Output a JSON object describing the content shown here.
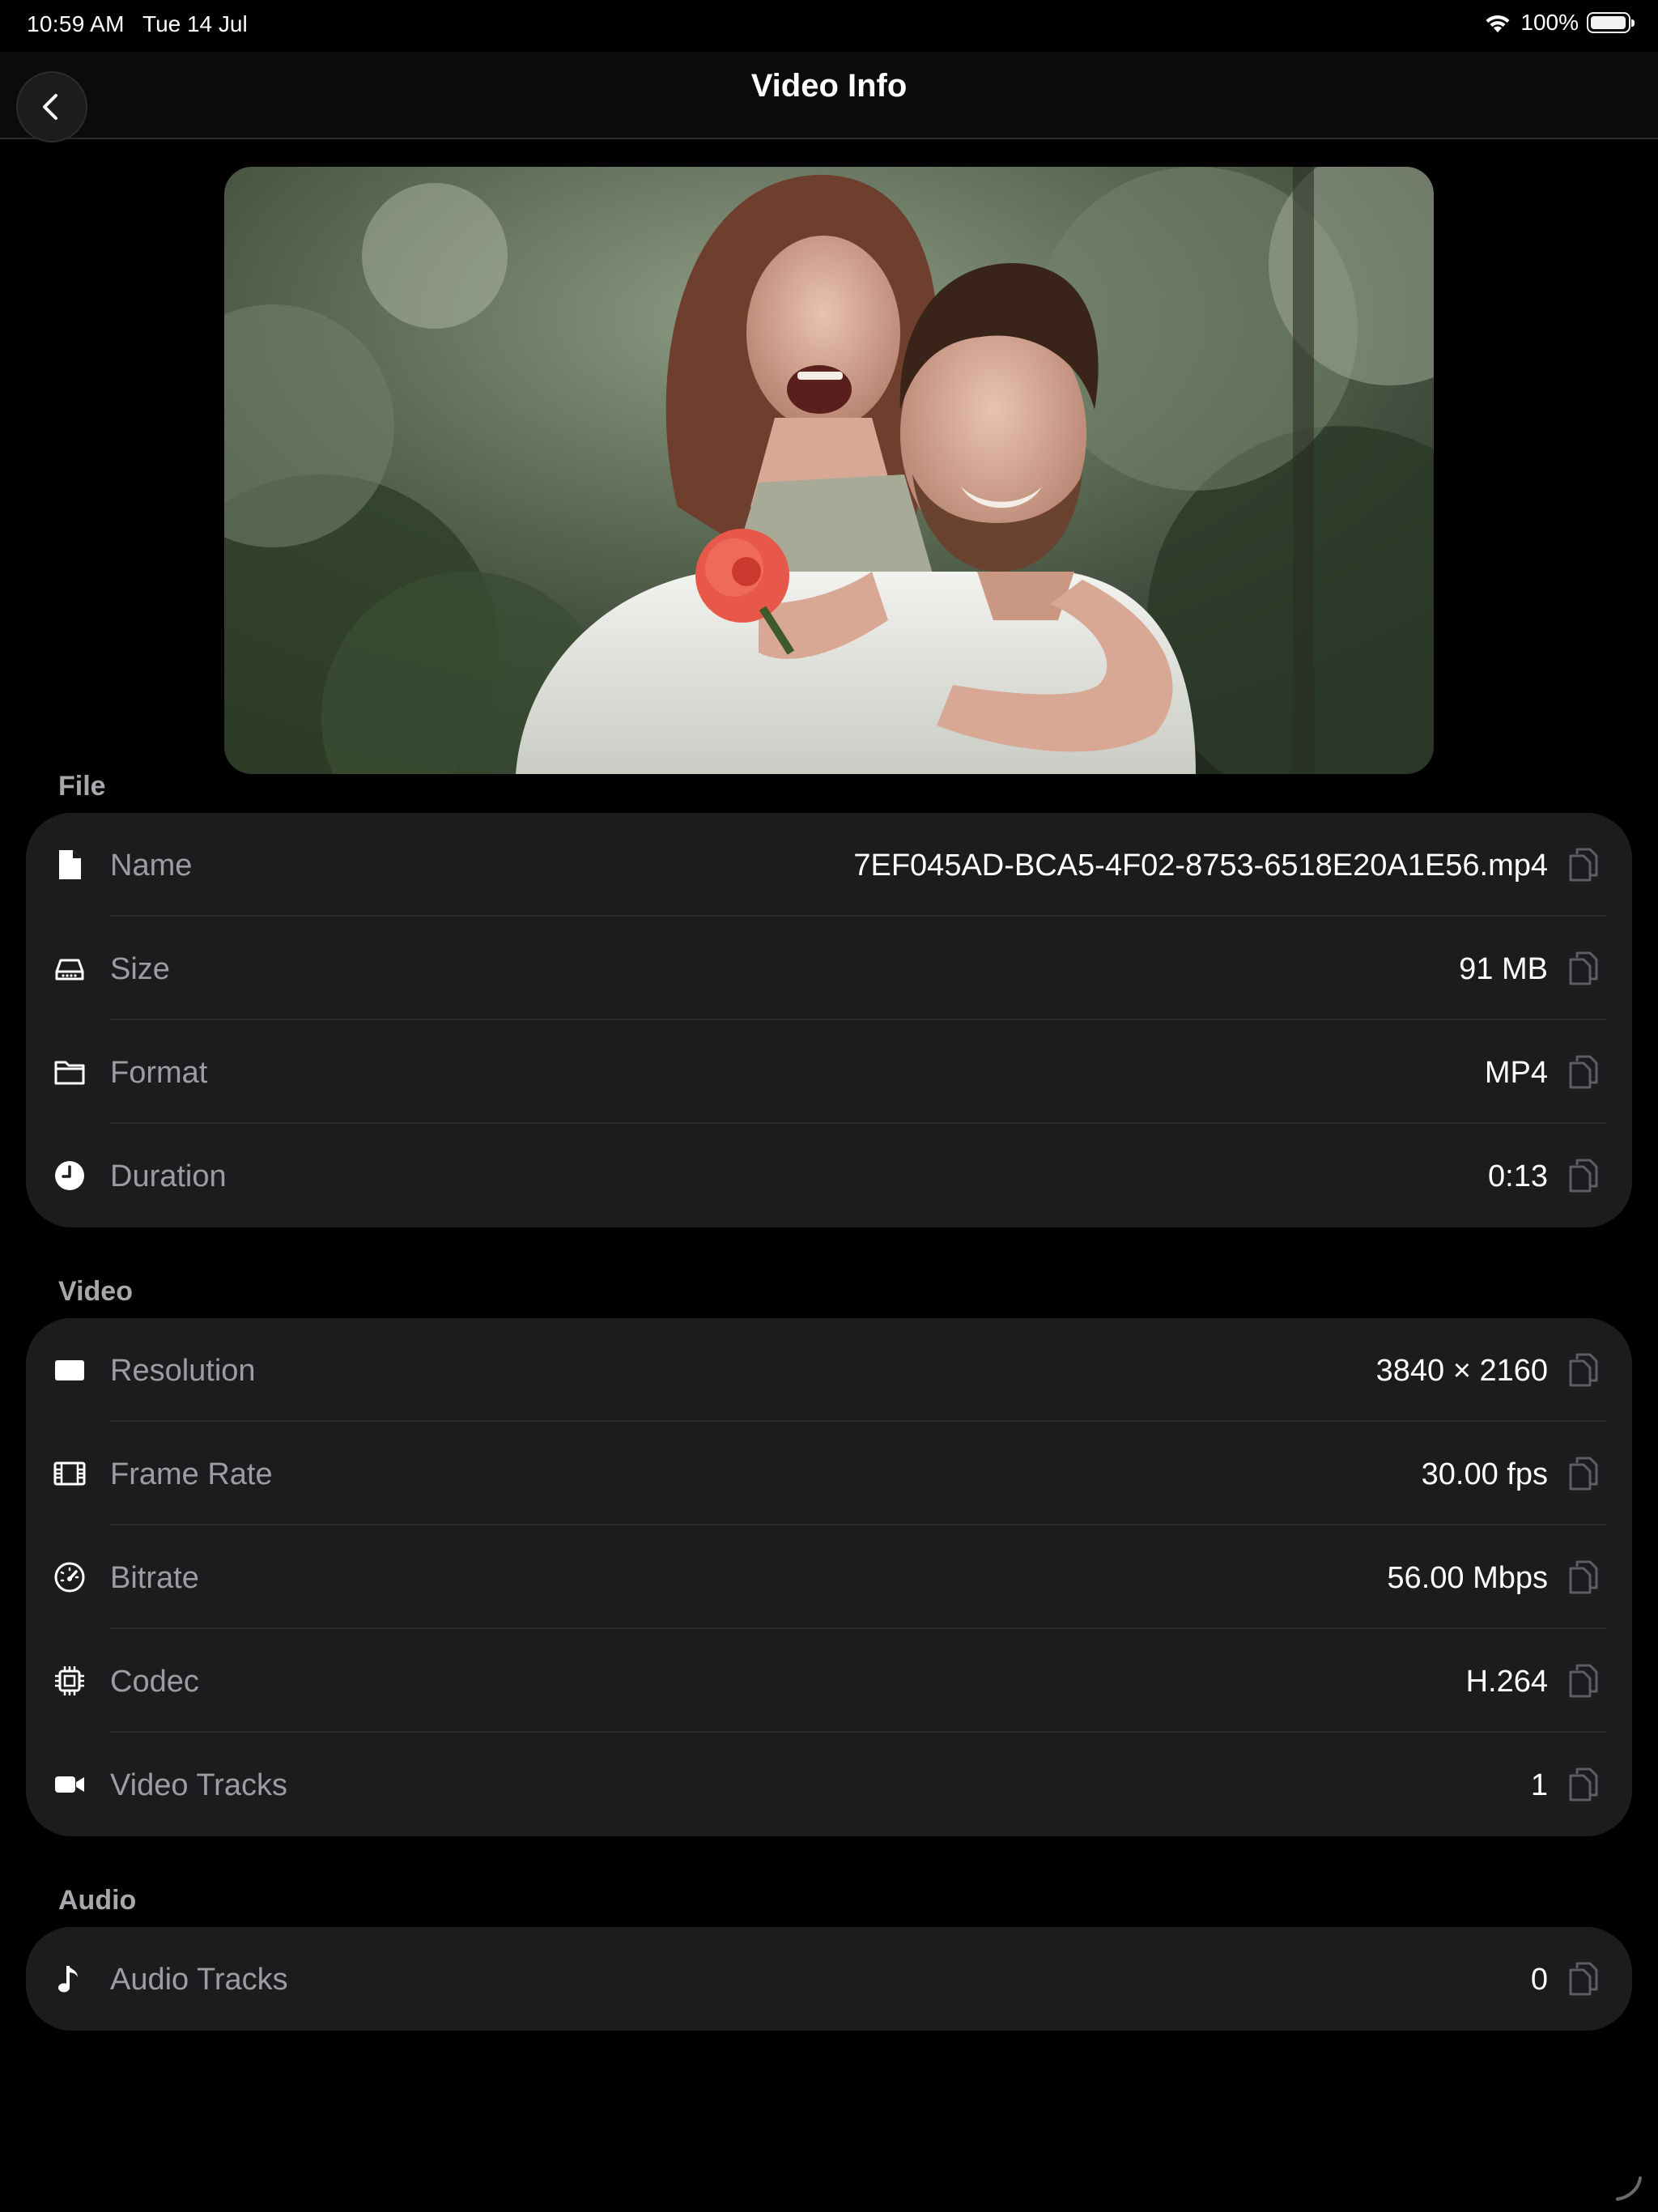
{
  "status_bar": {
    "time": "10:59 AM",
    "date": "Tue 14 Jul",
    "battery": "100%",
    "wifi_icon": "wifi-icon",
    "battery_icon": "battery-icon"
  },
  "nav": {
    "title": "Video Info",
    "back_icon": "chevron-left-icon"
  },
  "thumbnail": {
    "description_icon": "video-thumbnail"
  },
  "sections": {
    "file": {
      "header": "File",
      "rows": [
        {
          "label": "Name",
          "value": "7EF045AD-BCA5-4F02-8753-6518E20A1E56.mp4",
          "icon": "document-icon"
        },
        {
          "label": "Size",
          "value": "91 MB",
          "icon": "hard-drive-icon"
        },
        {
          "label": "Format",
          "value": "MP4",
          "icon": "folder-icon"
        },
        {
          "label": "Duration",
          "value": "0:13",
          "icon": "clock-icon"
        }
      ]
    },
    "video": {
      "header": "Video",
      "rows": [
        {
          "label": "Resolution",
          "value": "3840 × 2160",
          "icon": "display-icon"
        },
        {
          "label": "Frame Rate",
          "value": "30.00 fps",
          "icon": "film-icon"
        },
        {
          "label": "Bitrate",
          "value": "56.00 Mbps",
          "icon": "gauge-icon"
        },
        {
          "label": "Codec",
          "value": "H.264",
          "icon": "cpu-icon"
        },
        {
          "label": "Video Tracks",
          "value": "1",
          "icon": "video-camera-icon"
        }
      ]
    },
    "audio": {
      "header": "Audio",
      "rows": [
        {
          "label": "Audio Tracks",
          "value": "0",
          "icon": "music-note-icon"
        }
      ]
    }
  },
  "colors": {
    "background": "#000000",
    "card": "#1c1c1e",
    "label": "#9c9ca1",
    "value": "#ffffff",
    "section_header": "#a7a7ac"
  }
}
